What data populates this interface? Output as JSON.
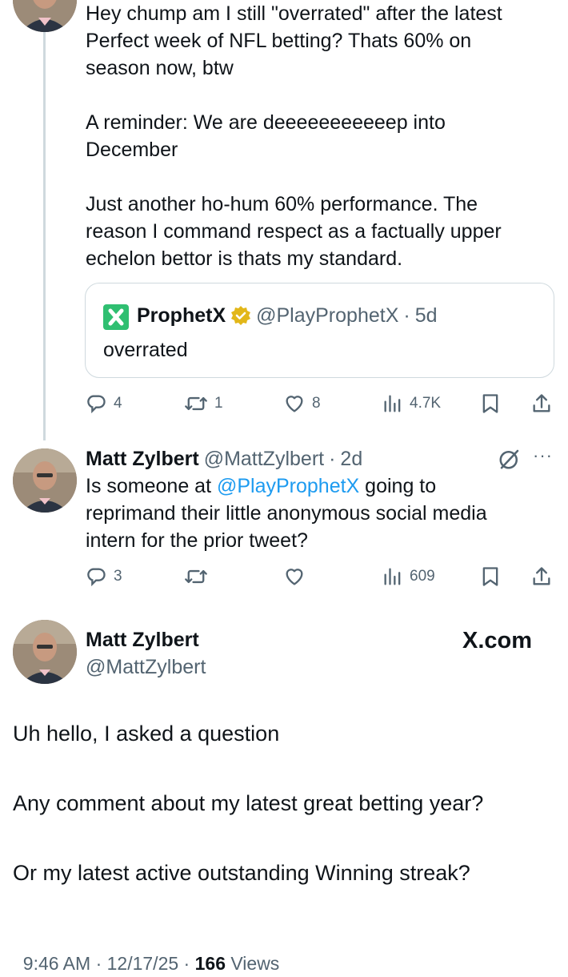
{
  "reply1": {
    "text_lines": [
      "Hey chump am I still \"overrated\" after the latest",
      "Perfect week of NFL betting? Thats 60% on",
      "season now, btw",
      "A reminder: We are deeeeeeeeeeep into",
      "December",
      "Just another ho-hum 60% performance. The",
      "reason I command respect as a factually upper",
      "echelon bettor is thats my standard."
    ],
    "quote": {
      "name": "ProphetX",
      "handle": "@PlayProphetX",
      "sep": "·",
      "time": "5d",
      "text": "overrated"
    },
    "actions": {
      "replies": "4",
      "reposts": "1",
      "likes": "8",
      "views": "4.7K"
    }
  },
  "reply2": {
    "name": "Matt Zylbert",
    "handle": "@MattZylbert",
    "sep": "·",
    "time": "2d",
    "line1_pre": "Is someone at ",
    "line1_mention": "@PlayProphetX",
    "line1_post": " going to",
    "line2": "reprimand their little anonymous social media",
    "line3": "intern for the prior tweet?",
    "more": "···",
    "actions": {
      "replies": "3",
      "reposts": "",
      "likes": "",
      "views": "609"
    }
  },
  "main": {
    "name": "Matt Zylbert",
    "handle": "@MattZylbert",
    "brand": "X.com",
    "lines": [
      "Uh hello, I asked a question",
      "Any comment about my latest great betting year?",
      "Or my latest active outstanding Winning streak?"
    ],
    "time": "9:46 AM",
    "sep": "·",
    "date": "12/17/25",
    "views_count": "166",
    "views_label": "Views"
  },
  "icons": {
    "reply": "reply-icon",
    "repost": "repost-icon",
    "like": "heart-icon",
    "views": "views-icon",
    "bookmark": "bookmark-icon",
    "share": "share-icon",
    "verified": "verified-badge-icon",
    "grok": "grok-icon"
  },
  "colors": {
    "link": "#1d9bf0",
    "muted": "#536471",
    "verified": "#e2b719",
    "prophetx": "#2fbf71"
  }
}
